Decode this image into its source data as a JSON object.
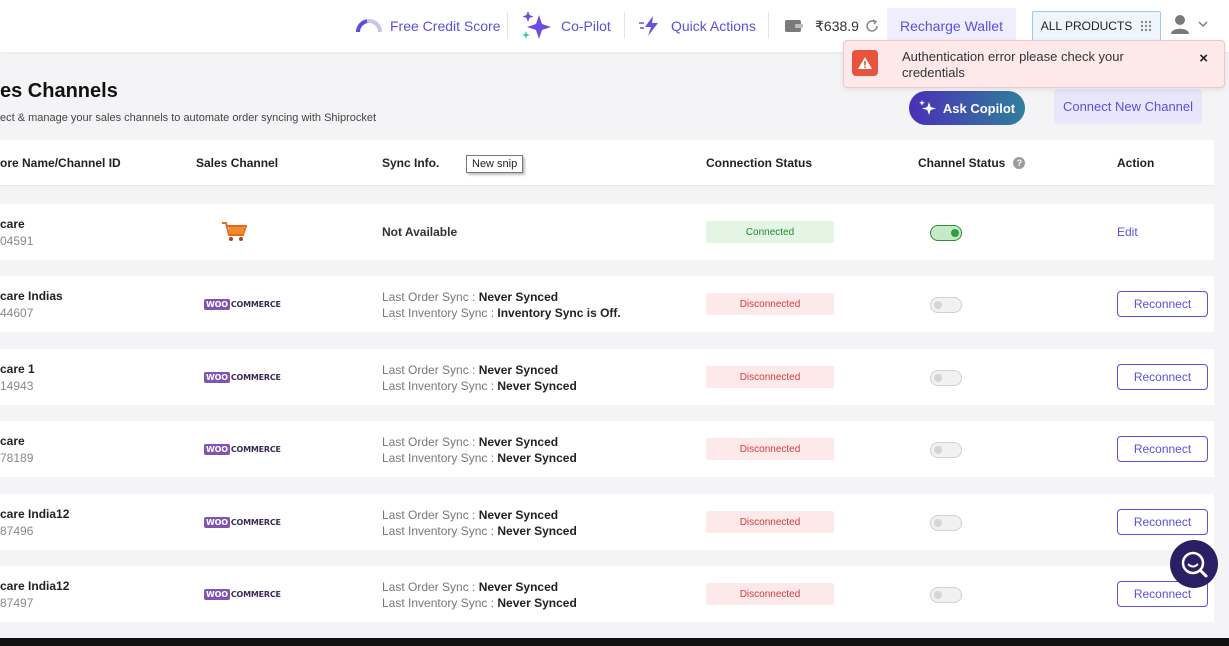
{
  "header": {
    "credit_score": "Free Credit Score",
    "copilot": "Co-Pilot",
    "quick_actions": "Quick Actions",
    "wallet_balance": "₹638.9",
    "recharge": "Recharge Wallet",
    "all_products": "ALL PRODUCTS"
  },
  "page": {
    "title": "es Channels",
    "subtitle": "ect & manage your sales channels to automate order syncing with Shiprocket",
    "ask_copilot": "Ask Copilot",
    "connect_new": "Connect New Channel"
  },
  "toast": {
    "message": "Authentication error please check your credentials",
    "close": "×"
  },
  "tooltip": "New snip",
  "table": {
    "headers": {
      "store": "ore Name/Channel ID",
      "channel": "Sales Channel",
      "sync": "Sync Info.",
      "connection": "Connection Status",
      "status": "Channel Status",
      "action": "Action"
    },
    "sync_labels": {
      "order": "Last Order Sync : ",
      "inventory": "Last Inventory Sync : "
    },
    "woo": {
      "w": "WOO",
      "c": "COMMERCE"
    },
    "rows": [
      {
        "name": "care",
        "id": "04591",
        "sync_na": "Not Available",
        "connection": "Connected",
        "action": "Edit"
      },
      {
        "name": "care Indias",
        "id": "44607",
        "order_sync": "Never Synced",
        "inventory_sync": "Inventory Sync is Off.",
        "connection": "Disconnected",
        "action": "Reconnect"
      },
      {
        "name": "care 1",
        "id": "14943",
        "order_sync": "Never Synced",
        "inventory_sync": "Never Synced",
        "connection": "Disconnected",
        "action": "Reconnect"
      },
      {
        "name": "care",
        "id": "78189",
        "order_sync": "Never Synced",
        "inventory_sync": "Never Synced",
        "connection": "Disconnected",
        "action": "Reconnect"
      },
      {
        "name": "care India12",
        "id": "87496",
        "order_sync": "Never Synced",
        "inventory_sync": "Never Synced",
        "connection": "Disconnected",
        "action": "Reconnect"
      },
      {
        "name": "care India12",
        "id": "87497",
        "order_sync": "Never Synced",
        "inventory_sync": "Never Synced",
        "connection": "Disconnected",
        "action": "Reconnect"
      }
    ]
  },
  "colors": {
    "accent": "#5b4fe0",
    "connected": "#1f8a2e",
    "disconnected": "#d63b3b",
    "error": "#e8533e"
  }
}
